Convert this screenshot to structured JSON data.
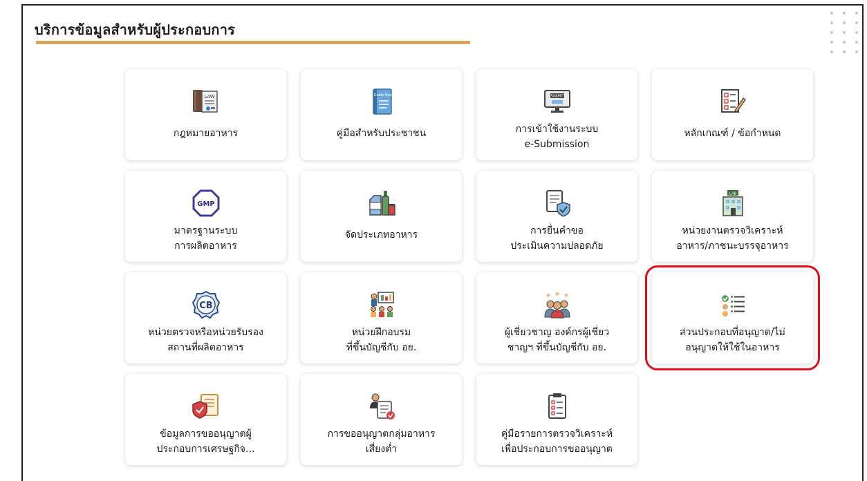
{
  "page": {
    "title": "บริการข้อมูลสำหรับผู้ประกอบการ"
  },
  "cards": [
    {
      "line1": "กฎหมายอาหาร",
      "line2": ""
    },
    {
      "line1": "คู่มือสำหรับประชาชน",
      "line2": ""
    },
    {
      "line1": "การเข้าใช้งานระบบ",
      "line2": "e-Submission"
    },
    {
      "line1": "หลักเกณฑ์ / ข้อกำหนด",
      "line2": ""
    },
    {
      "line1": "มาตรฐานระบบ",
      "line2": "การผลิตอาหาร"
    },
    {
      "line1": "จัดประเภทอาหาร",
      "line2": ""
    },
    {
      "line1": "การยื่นคำขอ",
      "line2": "ประเมินความปลอดภัย"
    },
    {
      "line1": "หน่วยงานตรวจวิเคราะห์",
      "line2": "อาหาร/ภาชนะบรรจุอาหาร"
    },
    {
      "line1": "หน่วยตรวจหรือหน่วยรับรอง",
      "line2": "สถานที่ผลิตอาหาร"
    },
    {
      "line1": "หน่วยฝึกอบรม",
      "line2": "ที่ขึ้นบัญชีกับ อย."
    },
    {
      "line1": "ผู้เชี่ยวชาญ องค์กรผู้เชี่ยว",
      "line2": "ชาญฯ ที่ขึ้นบัญชีกับ อย."
    },
    {
      "line1": "ส่วนประกอบที่อนุญาต/ไม่",
      "line2": "อนุญาตให้ใช้ในอาหาร"
    },
    {
      "line1": "ข้อมูลการขออนุญาตผู้",
      "line2": "ประกอบการเศรษฐกิจ..."
    },
    {
      "line1": "การขออนุญาตกลุ่มอาหาร",
      "line2": "เสี่ยงต่ำ"
    },
    {
      "line1": "คู่มือรายการตรวจวิเคราะห์",
      "line2": "เพื่อประกอบการขออนุญาต"
    }
  ],
  "icon_text": {
    "law": "LAW",
    "submit": "SUBMIT",
    "gmp": "GMP",
    "lab": "LAB",
    "cb": "CB",
    "guide": "Guide Book"
  },
  "colors": {
    "accent_underline": "#d9a45e",
    "highlight_border": "#e00e14"
  }
}
